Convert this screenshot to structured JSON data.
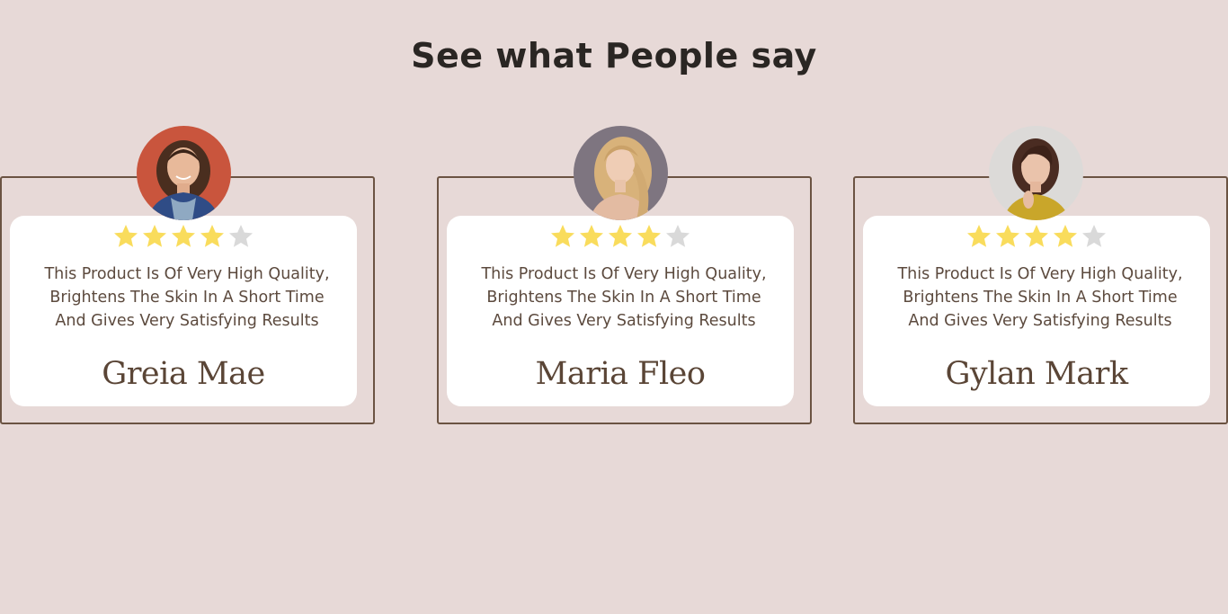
{
  "heading": "See what People say",
  "colors": {
    "background": "#e7d9d7",
    "frame": "#6b5342",
    "star_filled": "#f9dc5c",
    "star_empty": "#d9d9d9",
    "text": "#5c4a3e",
    "heading": "#2a2623"
  },
  "testimonials": [
    {
      "name": "Greia Mae",
      "avatar_icon": "woman-portrait-avatar",
      "rating": 4,
      "max_rating": 5,
      "review": "This Product Is Of Very High Quality,\nBrightens The Skin In A Short Time\nAnd Gives Very Satisfying Results"
    },
    {
      "name": "Maria Fleo",
      "avatar_icon": "woman-portrait-avatar",
      "rating": 4,
      "max_rating": 5,
      "review": "This Product Is Of Very High Quality,\nBrightens The Skin In A Short Time\nAnd Gives Very Satisfying Results"
    },
    {
      "name": "Gylan Mark",
      "avatar_icon": "woman-portrait-avatar",
      "rating": 4,
      "max_rating": 5,
      "review": "This Product Is Of Very High Quality,\nBrightens The Skin In A Short Time\nAnd Gives Very Satisfying Results"
    }
  ]
}
